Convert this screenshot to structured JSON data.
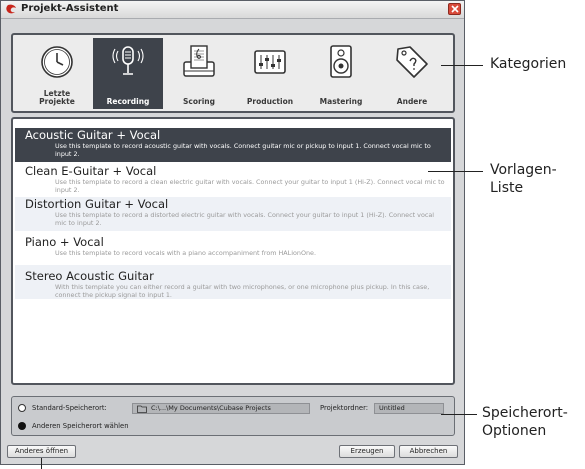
{
  "window": {
    "title": "Projekt-Assistent"
  },
  "categories": [
    {
      "label": "Letzte Projekte",
      "icon": "clock-icon",
      "active": false
    },
    {
      "label": "Recording",
      "icon": "microphone-icon",
      "active": true
    },
    {
      "label": "Scoring",
      "icon": "score-icon",
      "active": false
    },
    {
      "label": "Production",
      "icon": "mixer-icon",
      "active": false
    },
    {
      "label": "Mastering",
      "icon": "speaker-icon",
      "active": false
    },
    {
      "label": "Andere",
      "icon": "tag-icon",
      "active": false
    }
  ],
  "templates": [
    {
      "title": "Acoustic Guitar + Vocal",
      "description": "Use this template to record acoustic guitar with vocals. Connect guitar mic or pickup to input 1. Connect vocal mic to input 2.",
      "selected": true
    },
    {
      "title": "Clean E-Guitar + Vocal",
      "description": "Use this template to record a clean electric guitar with vocals. Connect your guitar to input 1 (Hi-Z). Connect vocal mic to input 2.",
      "selected": false
    },
    {
      "title": "Distortion Guitar + Vocal",
      "description": "Use this template to record a distorted electric guitar with vocals. Connect your guitar to input 1 (Hi-Z). Connect vocal mic to input 2.",
      "selected": false
    },
    {
      "title": "Piano + Vocal",
      "description": "Use this template to record vocals with a piano accompaniment from HALionOne.",
      "selected": false
    },
    {
      "title": "Stereo Acoustic Guitar",
      "description": "With this template you can either record a guitar with two microphones, or one microphone plus pickup. In this case, connect the pickup signal to input 1.",
      "selected": false
    }
  ],
  "storage": {
    "standard_label": "Standard-Speicherort:",
    "path": "C:\\...\\My Documents\\Cubase Projects",
    "folder_label": "Projektordner:",
    "folder_value": "Untitled",
    "other_label": "Anderen Speicherort wählen",
    "selected": "standard"
  },
  "buttons": {
    "open_other": "Anderes öffnen",
    "create": "Erzeugen",
    "cancel": "Abbrechen"
  },
  "callouts": {
    "categories": "Kategorien",
    "template_list_line1": "Vorlagen-",
    "template_list_line2": "Liste",
    "storage_line1": "Speicherort-",
    "storage_line2": "Optionen"
  },
  "colors": {
    "selected_bg": "#3e434b",
    "panel_border": "#52565d",
    "close_button": "#d94a3a"
  }
}
